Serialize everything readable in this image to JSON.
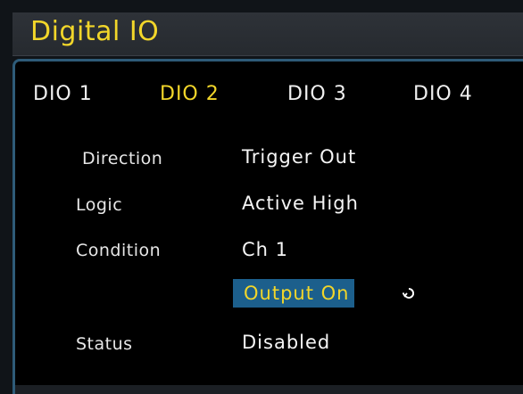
{
  "window": {
    "title": "Digital IO"
  },
  "tabs": [
    {
      "label": "DIO 1",
      "active": false
    },
    {
      "label": "DIO 2",
      "active": true
    },
    {
      "label": "DIO 3",
      "active": false
    },
    {
      "label": "DIO 4",
      "active": false
    }
  ],
  "settings": {
    "direction": {
      "label": "Direction",
      "value": "Trigger Out"
    },
    "logic": {
      "label": "Logic",
      "value": "Active High"
    },
    "condition": {
      "label": "Condition",
      "channel": "Ch 1",
      "event": "Output On"
    },
    "status": {
      "label": "Status",
      "value": "Disabled"
    }
  },
  "icons": {
    "cycle": "cycle-arrow-icon"
  },
  "colors": {
    "accent": "#f2d62a",
    "selection": "#1c5f8c",
    "panel_border": "#2e5b78"
  }
}
